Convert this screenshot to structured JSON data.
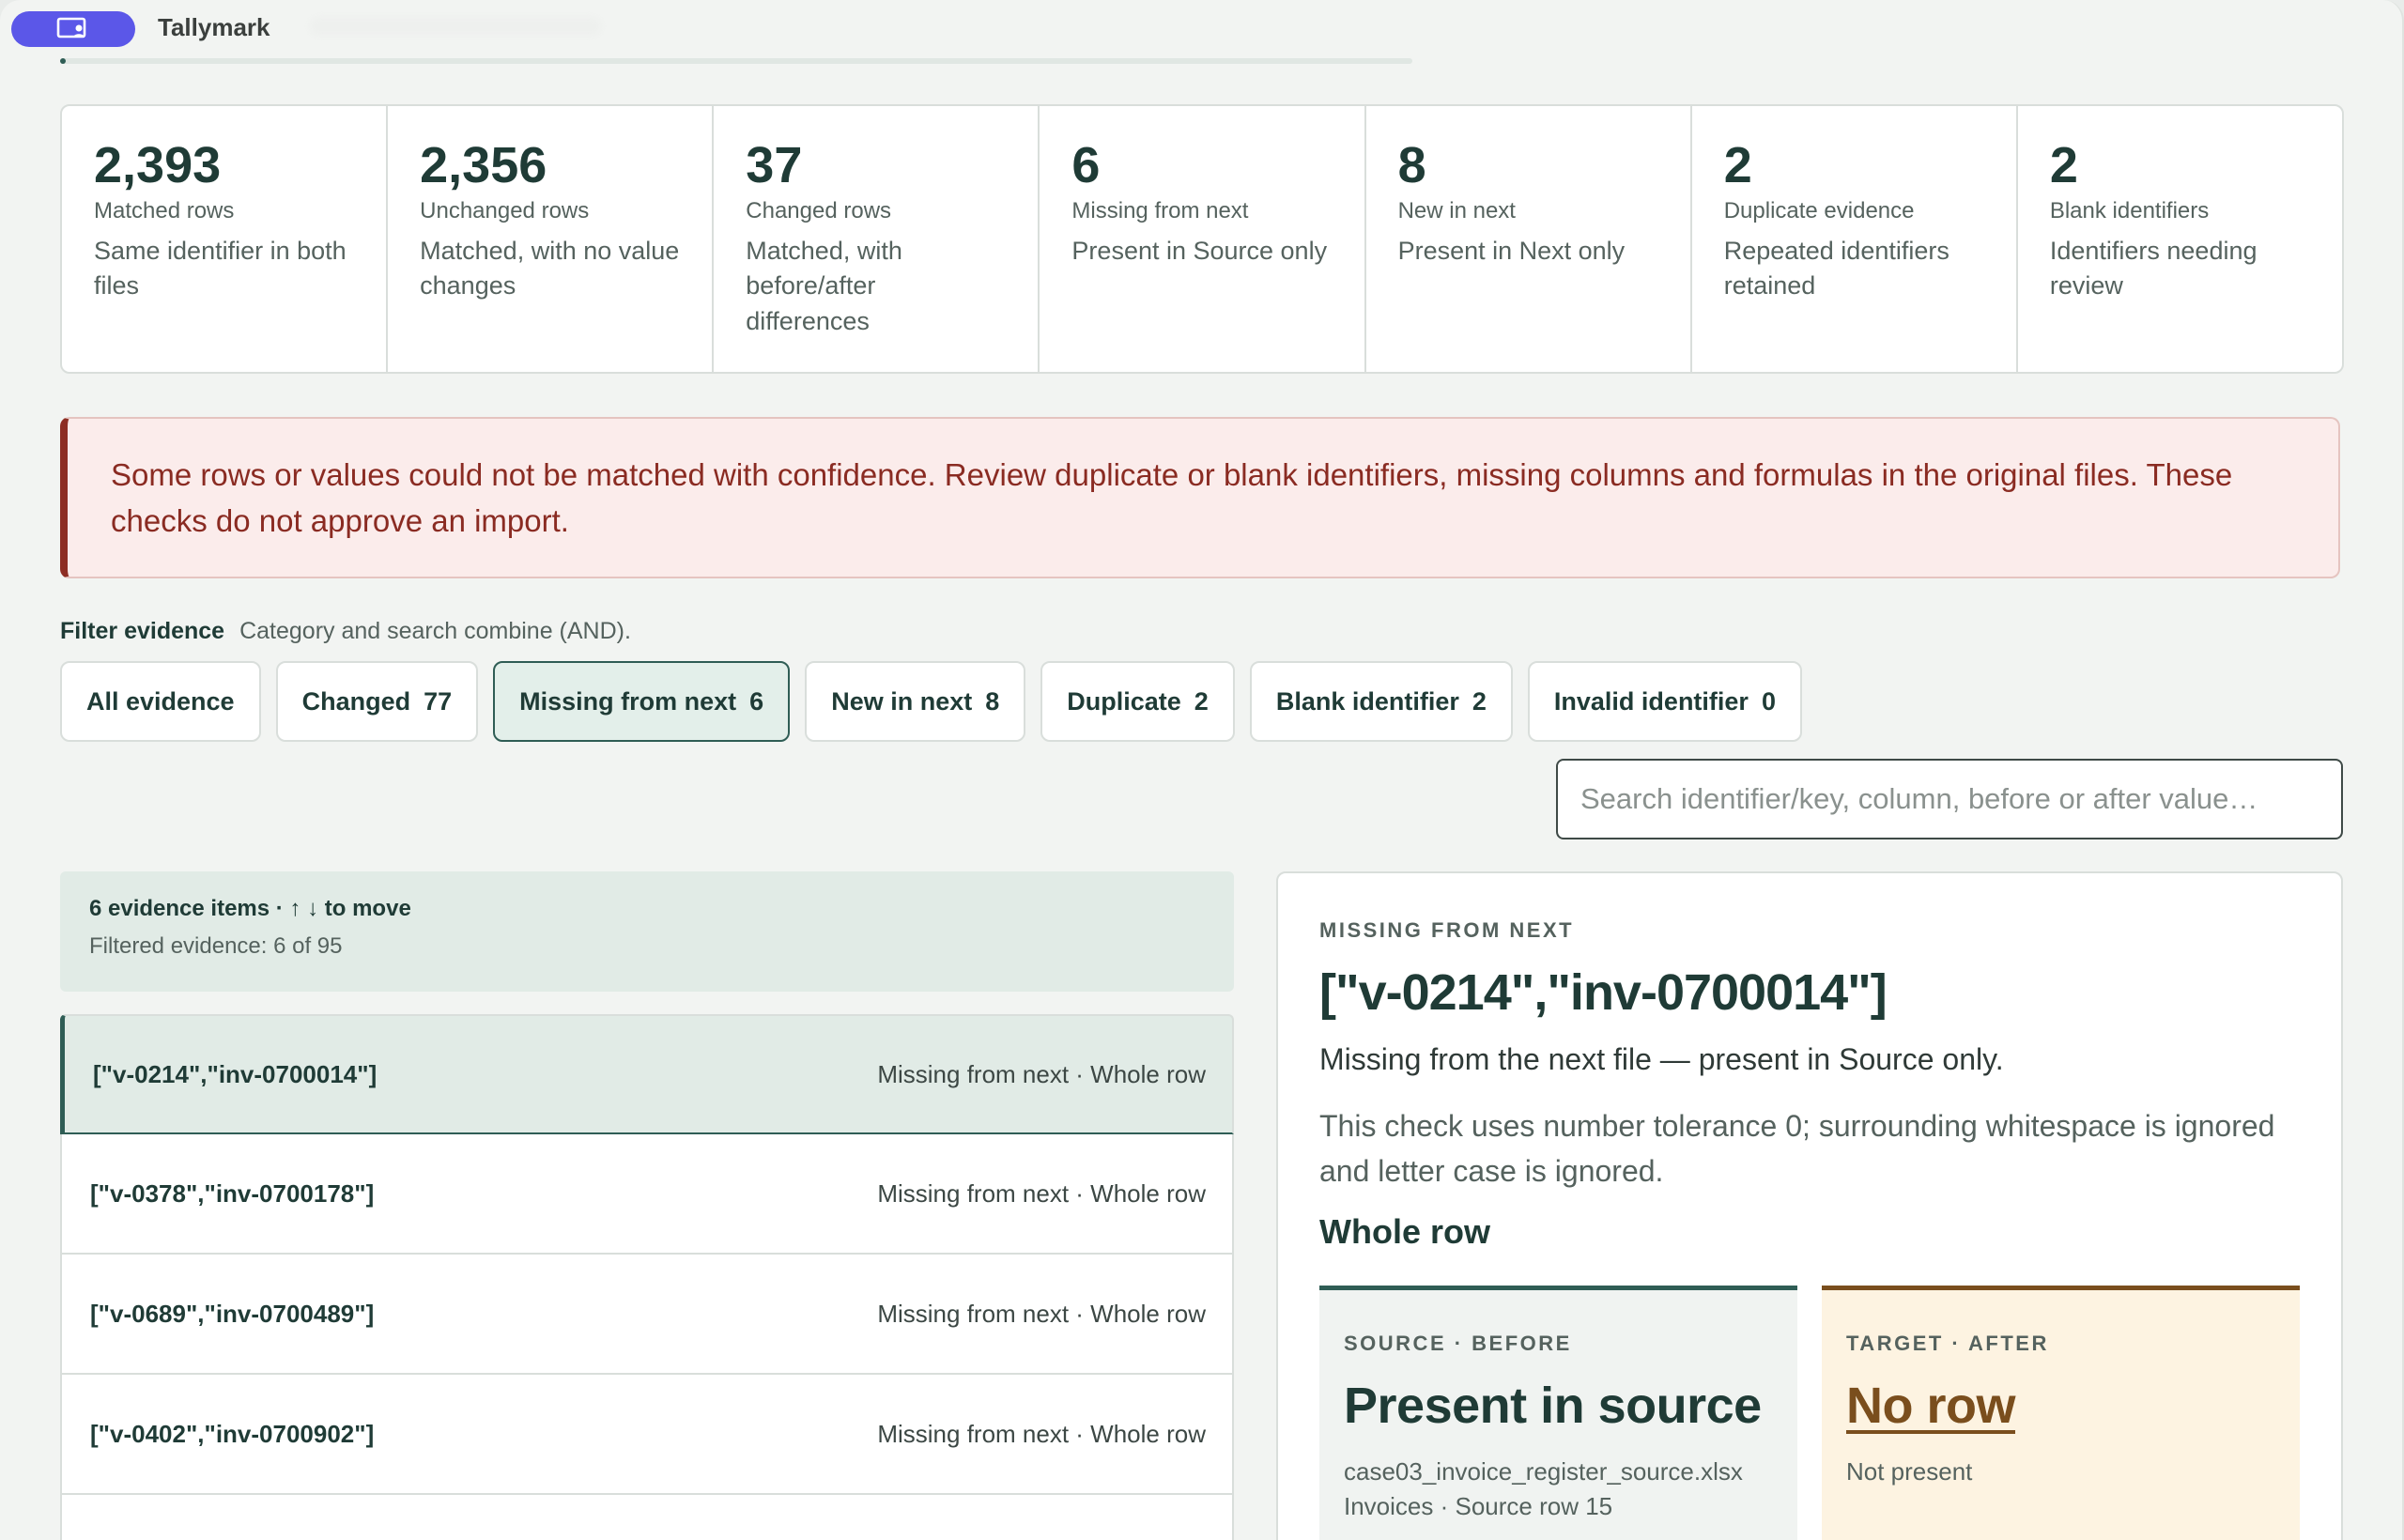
{
  "app": {
    "title": "Tallymark",
    "progress": 0.004
  },
  "stats": [
    {
      "value": "2,393",
      "label": "Matched rows",
      "desc": "Same identifier in both files"
    },
    {
      "value": "2,356",
      "label": "Unchanged rows",
      "desc": "Matched, with no value changes"
    },
    {
      "value": "37",
      "label": "Changed rows",
      "desc": "Matched, with before/after differences"
    },
    {
      "value": "6",
      "label": "Missing from next",
      "desc": "Present in Source only"
    },
    {
      "value": "8",
      "label": "New in next",
      "desc": "Present in Next only"
    },
    {
      "value": "2",
      "label": "Duplicate evidence",
      "desc": "Repeated identifiers retained"
    },
    {
      "value": "2",
      "label": "Blank identifiers",
      "desc": "Identifiers needing review"
    }
  ],
  "alert": {
    "text": "Some rows or values could not be matched with confidence. Review duplicate or blank identifiers, missing columns and formulas in the original files. These checks do not approve an import."
  },
  "filter": {
    "title": "Filter evidence",
    "hint": "Category and search combine (AND).",
    "chips": [
      {
        "label": "All evidence",
        "count": ""
      },
      {
        "label": "Changed",
        "count": "77"
      },
      {
        "label": "Missing from next",
        "count": "6"
      },
      {
        "label": "New in next",
        "count": "8"
      },
      {
        "label": "Duplicate",
        "count": "2"
      },
      {
        "label": "Blank identifier",
        "count": "2"
      },
      {
        "label": "Invalid identifier",
        "count": "0"
      }
    ],
    "search_placeholder": "Search identifier/key, column, before or after value…"
  },
  "list": {
    "summary": "6 evidence items · ↑ ↓ to move",
    "filtered": "Filtered evidence: 6 of 95",
    "items": [
      {
        "id": "[\"v-0214\",\"inv-0700014\"]",
        "meta": "Missing from next · Whole row"
      },
      {
        "id": "[\"v-0378\",\"inv-0700178\"]",
        "meta": "Missing from next · Whole row"
      },
      {
        "id": "[\"v-0689\",\"inv-0700489\"]",
        "meta": "Missing from next · Whole row"
      },
      {
        "id": "[\"v-0402\",\"inv-0700902\"]",
        "meta": "Missing from next · Whole row"
      },
      {
        "id": "",
        "meta": ""
      }
    ]
  },
  "detail": {
    "eyebrow": "MISSING FROM NEXT",
    "title": "[\"v-0214\",\"inv-0700014\"]",
    "subtitle": "Missing from the next file — present in Source only.",
    "note": "This check uses number tolerance 0; surrounding whitespace is ignored and letter case is ignored.",
    "scope": "Whole row",
    "source": {
      "label": "SOURCE · BEFORE",
      "value": "Present in source",
      "file": "case03_invoice_register_source.xlsx",
      "location": "Invoices · Source row 15"
    },
    "target": {
      "label": "TARGET · AFTER",
      "value": "No row",
      "note": "Not present"
    }
  }
}
